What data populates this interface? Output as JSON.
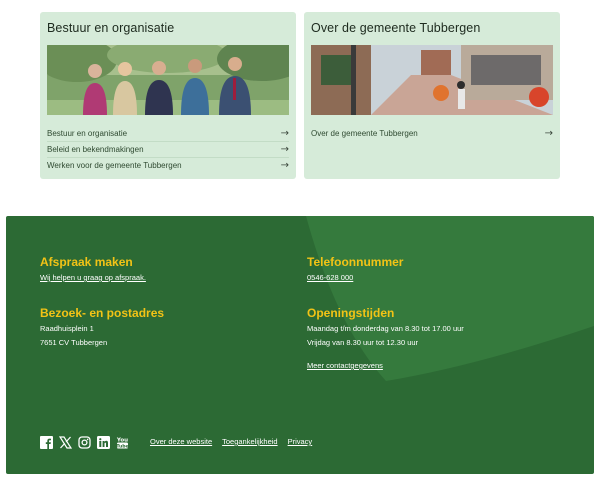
{
  "cards": [
    {
      "title": "Bestuur en organisatie",
      "image_alt": "Groepsfoto van het college",
      "links": [
        {
          "label": "Bestuur en organisatie"
        },
        {
          "label": "Beleid en bekendmakingen"
        },
        {
          "label": "Werken voor de gemeente Tubbergen"
        }
      ]
    },
    {
      "title": "Over de gemeente Tubbergen",
      "image_alt": "Winkelstraat in Tubbergen",
      "links": [
        {
          "label": "Over de gemeente Tubbergen"
        }
      ]
    }
  ],
  "arrow_glyph": "→",
  "footer": {
    "appointment": {
      "heading": "Afspraak maken",
      "link": "Wij helpen u graag op afspraak."
    },
    "phone": {
      "heading": "Telefoonnummer",
      "number": "0546-628 000"
    },
    "address": {
      "heading": "Bezoek- en postadres",
      "line1": "Raadhuisplein 1",
      "line2": "7651 CV Tubbergen"
    },
    "hours": {
      "heading": "Openingstijden",
      "line1": "Maandag t/m donderdag van 8.30 tot 17.00 uur",
      "line2": "Vrijdag van 8.30 uur tot 12.30 uur",
      "more": "Meer contactgegevens"
    },
    "social_icons": [
      "facebook-icon",
      "x-icon",
      "instagram-icon",
      "linkedin-icon",
      "youtube-icon"
    ],
    "bottom_links": [
      "Over deze website",
      "Toegankelijkheid",
      "Privacy"
    ],
    "colors": {
      "background": "#2c6a34",
      "accent": "#f2c316",
      "deco": "#357a3d"
    }
  }
}
